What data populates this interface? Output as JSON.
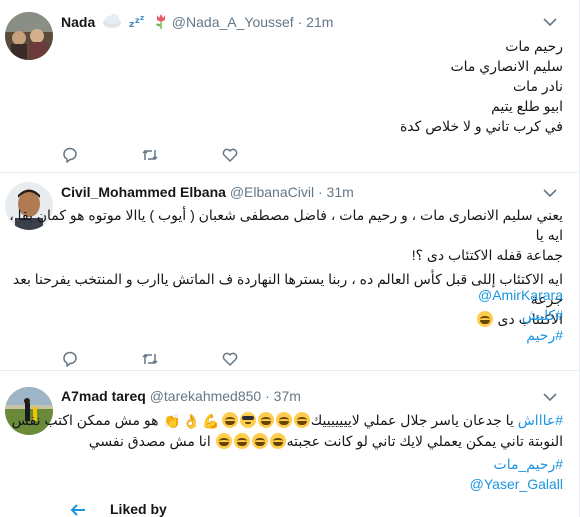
{
  "tweets": [
    {
      "name": "Nada",
      "handle": "@Nada_A_Youssef",
      "time": "21m",
      "lines": [
        "رحيم مات",
        "سليم الانصاري مات",
        "نادر مات",
        "ابيو طلع يتيم",
        "في كرب تاني و لا خلاص كدة"
      ]
    },
    {
      "name": "Civil_Mohammed Elbana",
      "handle": "@ElbanaCivil",
      "time": "31m",
      "lines": [
        "يعني سليم الانصارى مات ، و رحيم مات ، فاضل مصطفى شعبان ( أيوب ) ياالا موتوه هو كمان بقا ، ايه يا",
        "جماعة قفله الاكتئاب دى ؟!",
        "ايه الاكتئاب إللى قبل كأس العالم ده ، ربنا يسترها النهاردة ف الماتش ياارب و المنتخب يفرحنا بعد جرعة",
        "الاكتئاب دى"
      ],
      "mention": "@AmirKarara",
      "hashtags": [
        "#كلبش",
        "#رحيم"
      ]
    },
    {
      "name": "A7mad tareq",
      "handle": "@tarekahmed850",
      "time": "37m",
      "line1_a": "#عاااش",
      "line1_b": "يا جدعان ياسر جلال عملي لايييييييك",
      "line1_c": "هو مش ممكن اكتب نفس",
      "line2_a": "النوبتة تاني يمكن يعملي لايك تاني لو كانت عجبته",
      "line2_b": "انا مش مصدق نفسي",
      "hashtag": "#رحيم_مات",
      "mention": "@Yaser_Galall"
    }
  ],
  "footer": {
    "label": "Liked by"
  },
  "separator": "·"
}
